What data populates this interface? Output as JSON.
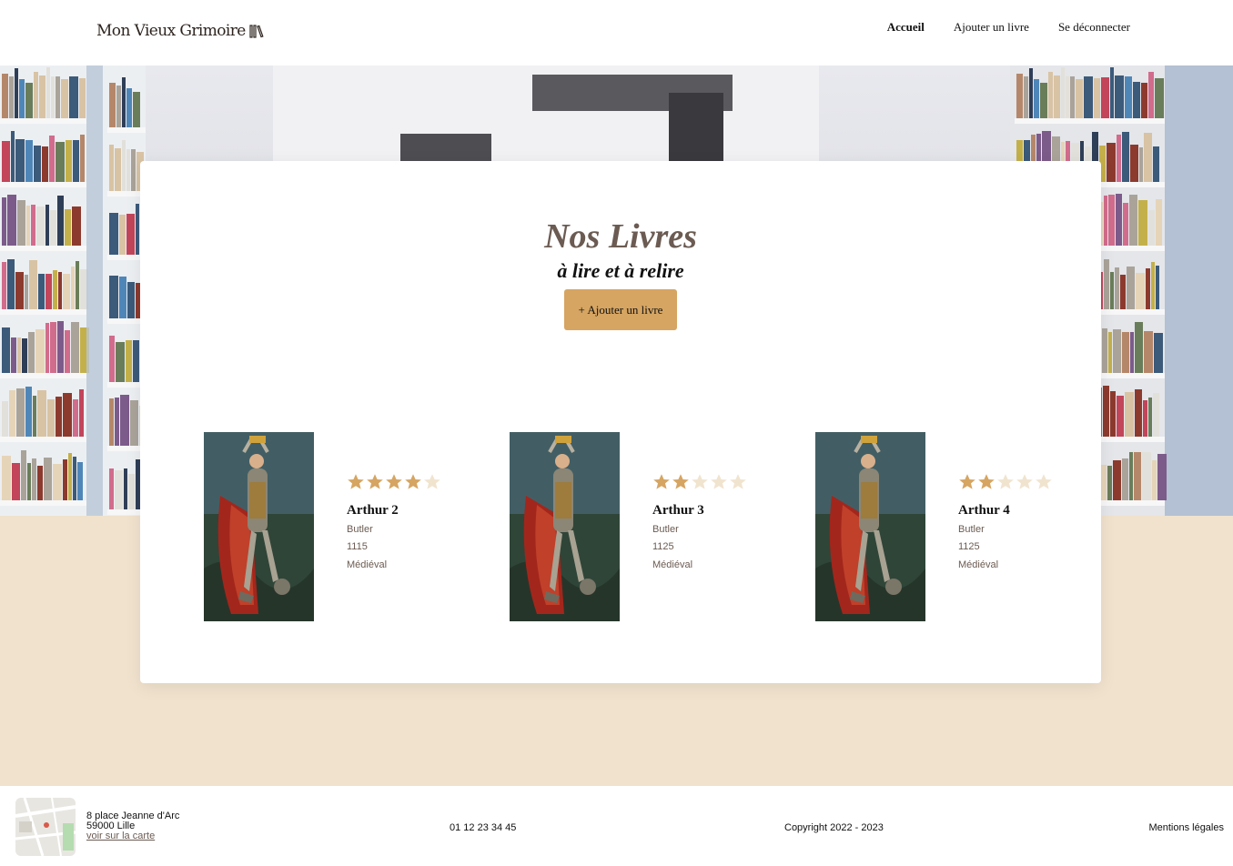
{
  "header": {
    "logo_text": "Mon Vieux Grimoire",
    "logo_icon": "book-spines-icon",
    "nav": [
      {
        "label": "Accueil",
        "active": true
      },
      {
        "label": "Ajouter un livre",
        "active": false
      },
      {
        "label": "Se déconnecter",
        "active": false
      }
    ]
  },
  "main": {
    "title": "Nos Livres",
    "subtitle": "à lire et à relire",
    "add_button": "+ Ajouter un livre",
    "books": [
      {
        "title": "Arthur 2",
        "author": "Butler",
        "year": "1115",
        "genre": "Médiéval",
        "rating": 4,
        "max_rating": 5
      },
      {
        "title": "Arthur 3",
        "author": "Butler",
        "year": "1125",
        "genre": "Médiéval",
        "rating": 2,
        "max_rating": 5
      },
      {
        "title": "Arthur 4",
        "author": "Butler",
        "year": "1125",
        "genre": "Médiéval",
        "rating": 2,
        "max_rating": 5
      }
    ]
  },
  "footer": {
    "address_line1": "8 place Jeanne d'Arc",
    "address_line2": "59000 Lille",
    "map_link": "voir sur la carte",
    "phone": "01 12 23 34 45",
    "copyright": "Copyright 2022 - 2023",
    "legal": "Mentions légales"
  },
  "colors": {
    "accent": "#d6a562",
    "star_empty": "#f1e4cf",
    "page_bg": "#f0e2cd",
    "title": "#6b5b52"
  }
}
